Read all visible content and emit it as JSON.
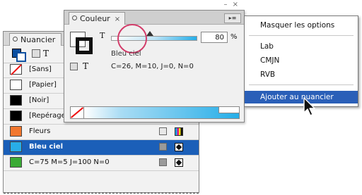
{
  "nuancier": {
    "tab_label": "Nuancier",
    "tool_letter": "T",
    "swatches": [
      {
        "name": "[Sans]",
        "chip": "none"
      },
      {
        "name": "[Papier]",
        "chip": "#ffffff"
      },
      {
        "name": "[Noir]",
        "chip": "#000000"
      },
      {
        "name": "[Repérage]",
        "chip": "#000000"
      },
      {
        "name": "Fleurs",
        "chip": "#f2772e"
      },
      {
        "name": "Bleu ciel",
        "chip": "#28aee8",
        "selected": true
      },
      {
        "name": "C=75 M=5 J=100 N=0",
        "chip": "#3aaa35"
      }
    ]
  },
  "couleur": {
    "tab_label": "Couleur",
    "close_glyph": "×",
    "window_buttons": "– ×",
    "tint_letter": "T",
    "tint_value": "80",
    "tint_level": 0.45,
    "tint_unit": "%",
    "text_letter": "T",
    "swatch_name": "Bleu ciel",
    "cmyk_values": "C=26, M=10, J=0, N=0",
    "menu_glyph": "▸≡"
  },
  "flyout_menu": {
    "items": [
      {
        "label": "Masquer les options"
      },
      {
        "label": "Lab"
      },
      {
        "label": "CMJN"
      },
      {
        "label": "RVB"
      },
      {
        "label": "Ajouter au nuancier",
        "highlighted": true
      }
    ]
  },
  "colors": {
    "selection_blue": "#1b5fb8",
    "menu_highlight": "#2a5fb8",
    "ciel": "#26aee8",
    "annotation_circle": "#d33c6a"
  }
}
